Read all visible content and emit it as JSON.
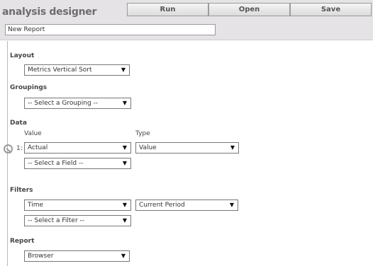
{
  "header": {
    "title": "analysis designer",
    "buttons": {
      "run": "Run",
      "open": "Open",
      "save": "Save"
    },
    "report_name": "New Report"
  },
  "layout": {
    "label": "Layout",
    "selected": "Metrics Vertical Sort"
  },
  "groupings": {
    "label": "Groupings",
    "selected": "-- Select a Grouping --"
  },
  "data": {
    "label": "Data",
    "value_header": "Value",
    "type_header": "Type",
    "rows": [
      {
        "index": "1:",
        "value": "Actual",
        "type": "Value"
      }
    ],
    "add_field": "-- Select a Field --"
  },
  "filters": {
    "label": "Filters",
    "rows": [
      {
        "field": "Time",
        "value": "Current Period"
      }
    ],
    "add_filter": "-- Select a Filter --"
  },
  "report": {
    "label": "Report",
    "selected": "Browser"
  },
  "icons": {
    "dropdown": "triangle-down-icon",
    "remove_row": "no-symbol-icon"
  }
}
